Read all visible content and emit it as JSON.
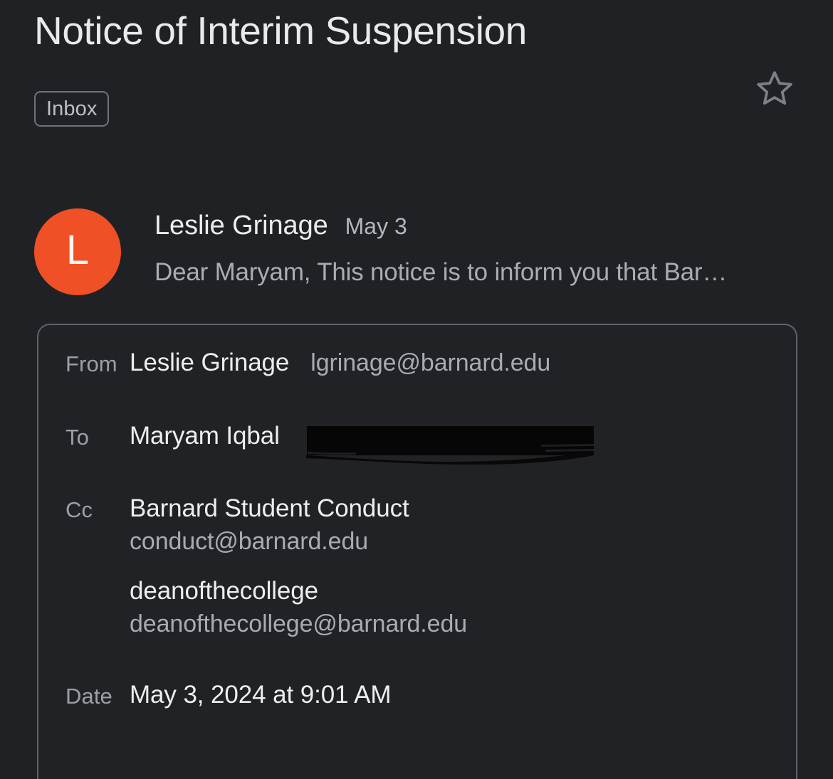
{
  "header": {
    "subject": "Notice of Interim Suspension",
    "label_chip": "Inbox",
    "star_state": "unstarred"
  },
  "message_summary": {
    "avatar_initial": "L",
    "avatar_color": "#ef5026",
    "sender_name": "Leslie Grinage",
    "date_short": "May 3",
    "snippet": "Dear Maryam, This notice is to inform you that Bar…"
  },
  "details": {
    "from": {
      "label": "From",
      "name": "Leslie Grinage",
      "email": "lgrinage@barnard.edu"
    },
    "to": {
      "label": "To",
      "name": "Maryam Iqbal",
      "email_redacted": true
    },
    "cc": {
      "label": "Cc",
      "recipients": [
        {
          "name": "Barnard Student Conduct",
          "email": "conduct@barnard.edu"
        },
        {
          "name": "deanofthecollege",
          "email": "deanofthecollege@barnard.edu"
        }
      ]
    },
    "date": {
      "label": "Date",
      "value": "May 3, 2024 at 9:01 AM"
    }
  },
  "colors": {
    "background": "#202124",
    "card_border": "#5f6368",
    "text_primary": "#eceef0",
    "text_secondary": "#a8acb1",
    "text_label": "#9aa0a6",
    "accent_avatar": "#ef5026",
    "redaction": "#050505"
  }
}
